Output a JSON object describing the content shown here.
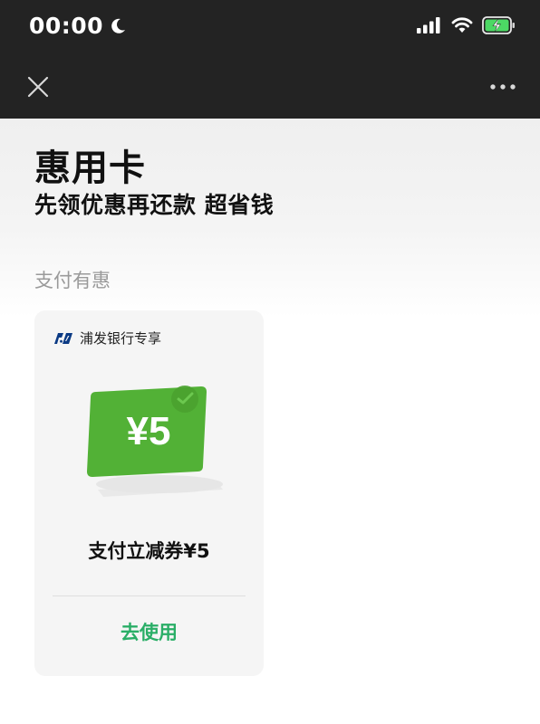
{
  "status_bar": {
    "time": "00:00",
    "icons": [
      "moon-icon",
      "signal-icon",
      "wifi-icon",
      "battery-charging-icon"
    ]
  },
  "nav": {
    "close_icon": "close-icon",
    "more_icon": "more-icon"
  },
  "hero": {
    "title": "惠用卡",
    "subtitle": "先领优惠再还款 超省钱"
  },
  "section": {
    "label": "支付有惠"
  },
  "coupon": {
    "bank_logo": "spdb-logo",
    "bank_name": "浦发银行专享",
    "amount_text": "¥5",
    "name": "支付立减券¥5",
    "action_label": "去使用"
  },
  "colors": {
    "topbar_bg": "#232323",
    "accent_green": "#2aae67",
    "card_green": "#52b136",
    "battery_green": "#4cd964"
  }
}
